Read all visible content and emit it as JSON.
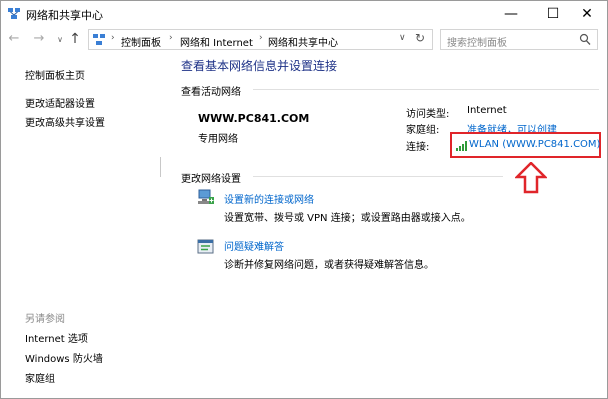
{
  "window": {
    "title": "网络和共享中心",
    "minimize": "—",
    "maximize": "☐",
    "close": "✕"
  },
  "nav": {
    "back": "←",
    "forward": "→",
    "history": "∨",
    "up": "↑",
    "breadcrumb": [
      "控制面板",
      "网络和 Internet",
      "网络和共享中心"
    ],
    "search_placeholder": "搜索控制面板"
  },
  "sidebar": {
    "items": [
      "控制面板主页",
      "更改适配器设置",
      "更改高级共享设置"
    ],
    "see_also_label": "另请参阅",
    "see_also": [
      "Internet 选项",
      "Windows 防火墙",
      "家庭组"
    ]
  },
  "main": {
    "title": "查看基本网络信息并设置连接",
    "active_networks_label": "查看活动网络",
    "network_name": "WWW.PC841.COM",
    "network_type": "专用网络",
    "access_type_label": "访问类型:",
    "access_type_value": "Internet",
    "homegroup_label": "家庭组:",
    "homegroup_value": "准备就绪，可以创建",
    "connection_label": "连接:",
    "connection_value": "WLAN (WWW.PC841.COM)",
    "change_settings_label": "更改网络设置",
    "tasks": [
      {
        "title": "设置新的连接或网络",
        "desc": "设置宽带、拨号或 VPN 连接；或设置路由器或接入点。",
        "icon": "new-connection-icon"
      },
      {
        "title": "问题疑难解答",
        "desc": "诊断并修复网络问题，或者获得疑难解答信息。",
        "icon": "troubleshoot-icon"
      }
    ]
  },
  "colors": {
    "link": "#0066cc",
    "title": "#1e3287",
    "highlight_border": "#e0252a",
    "muted": "#8a8a8a"
  }
}
